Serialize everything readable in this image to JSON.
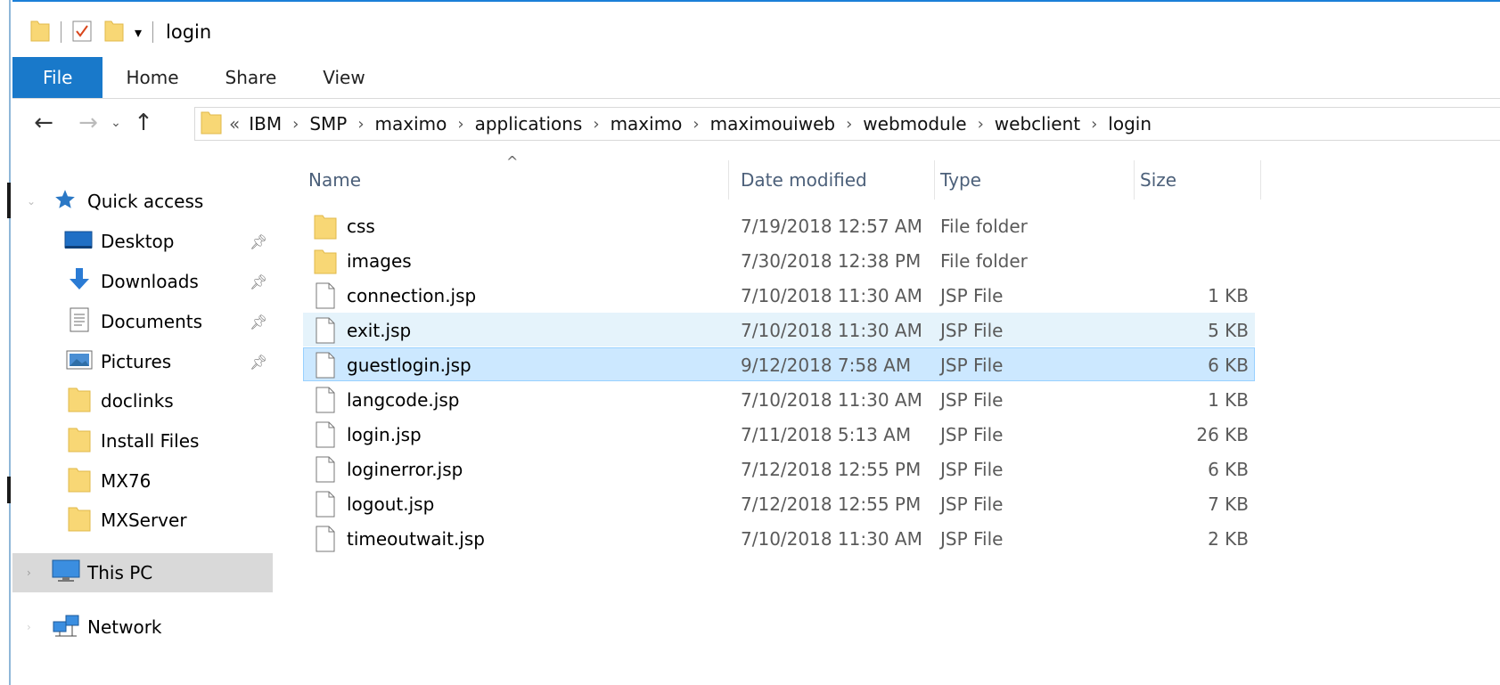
{
  "window": {
    "title": "login",
    "accent_color": "#1979ca",
    "folder_color": "#f8d775"
  },
  "ribbon": {
    "tabs": [
      {
        "label": "File",
        "active": true
      },
      {
        "label": "Home"
      },
      {
        "label": "Share"
      },
      {
        "label": "View"
      }
    ]
  },
  "nav": {
    "back_icon": "arrow-left-icon",
    "forward_icon": "arrow-right-icon",
    "recent_icon": "chevron-down-icon",
    "up_icon": "arrow-up-icon"
  },
  "address": {
    "overflow": "«",
    "crumbs": [
      "IBM",
      "SMP",
      "maximo",
      "applications",
      "maximo",
      "maximouiweb",
      "webmodule",
      "webclient",
      "login"
    ]
  },
  "sidebar": {
    "quick_access": "Quick access",
    "items": [
      {
        "label": "Desktop",
        "icon": "desktop-icon",
        "pinned": true
      },
      {
        "label": "Downloads",
        "icon": "downloads-icon",
        "pinned": true
      },
      {
        "label": "Documents",
        "icon": "documents-icon",
        "pinned": true
      },
      {
        "label": "Pictures",
        "icon": "pictures-icon",
        "pinned": true
      },
      {
        "label": "doclinks",
        "icon": "folder-icon",
        "pinned": false
      },
      {
        "label": "Install Files",
        "icon": "folder-icon",
        "pinned": false
      },
      {
        "label": "MX76",
        "icon": "folder-icon",
        "pinned": false
      },
      {
        "label": "MXServer",
        "icon": "folder-icon",
        "pinned": false
      }
    ],
    "this_pc": "This PC",
    "network": "Network"
  },
  "columns": {
    "name": "Name",
    "date": "Date modified",
    "type": "Type",
    "size": "Size"
  },
  "files": [
    {
      "name": "css",
      "date": "7/19/2018 12:57 AM",
      "type": "File folder",
      "size": "",
      "kind": "folder"
    },
    {
      "name": "images",
      "date": "7/30/2018 12:38 PM",
      "type": "File folder",
      "size": "",
      "kind": "folder"
    },
    {
      "name": "connection.jsp",
      "date": "7/10/2018 11:30 AM",
      "type": "JSP File",
      "size": "1 KB",
      "kind": "file"
    },
    {
      "name": "exit.jsp",
      "date": "7/10/2018 11:30 AM",
      "type": "JSP File",
      "size": "5 KB",
      "kind": "file",
      "state": "hover"
    },
    {
      "name": "guestlogin.jsp",
      "date": "9/12/2018 7:58 AM",
      "type": "JSP File",
      "size": "6 KB",
      "kind": "file",
      "state": "selected"
    },
    {
      "name": "langcode.jsp",
      "date": "7/10/2018 11:30 AM",
      "type": "JSP File",
      "size": "1 KB",
      "kind": "file"
    },
    {
      "name": "login.jsp",
      "date": "7/11/2018 5:13 AM",
      "type": "JSP File",
      "size": "26 KB",
      "kind": "file"
    },
    {
      "name": "loginerror.jsp",
      "date": "7/12/2018 12:55 PM",
      "type": "JSP File",
      "size": "6 KB",
      "kind": "file"
    },
    {
      "name": "logout.jsp",
      "date": "7/12/2018 12:55 PM",
      "type": "JSP File",
      "size": "7 KB",
      "kind": "file"
    },
    {
      "name": "timeoutwait.jsp",
      "date": "7/10/2018 11:30 AM",
      "type": "JSP File",
      "size": "2 KB",
      "kind": "file"
    }
  ]
}
